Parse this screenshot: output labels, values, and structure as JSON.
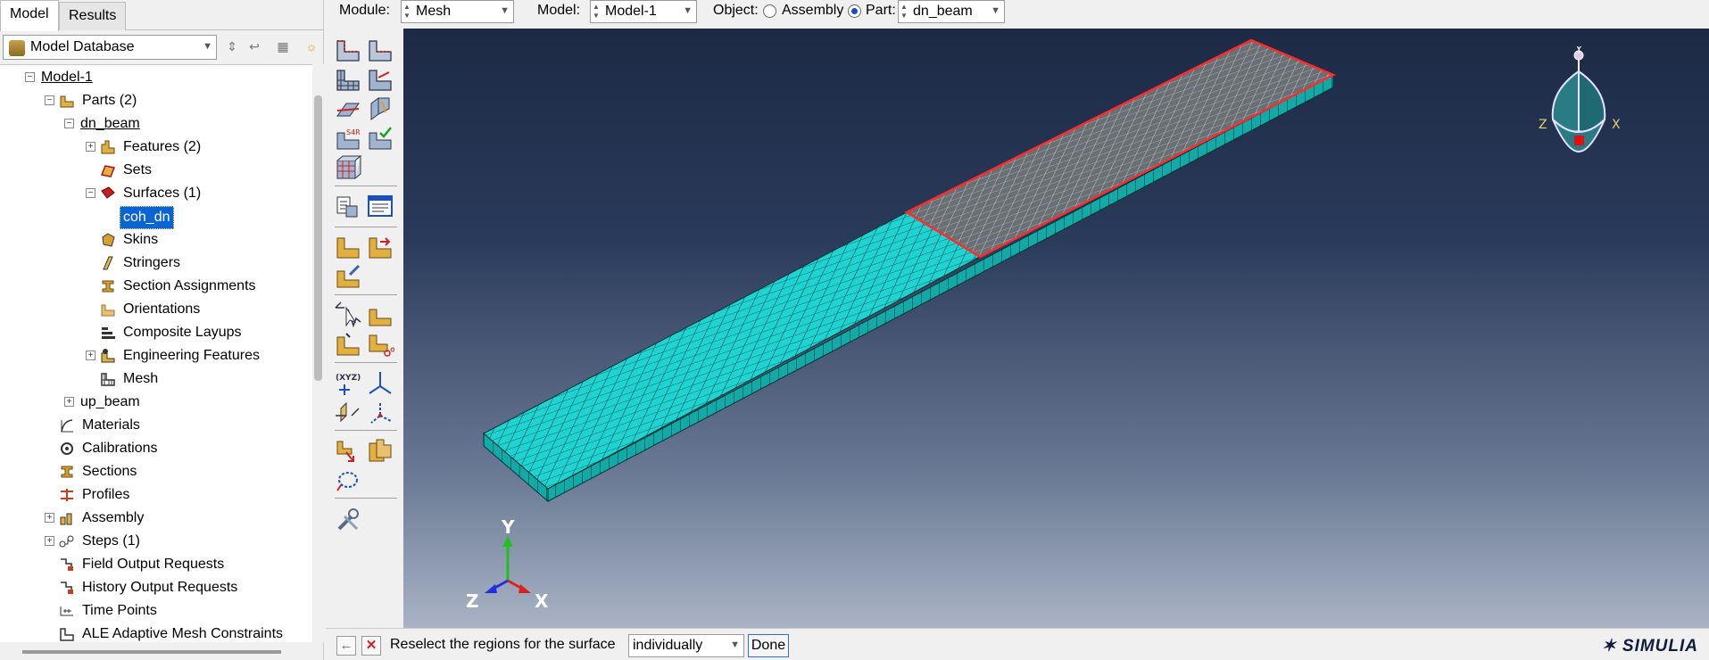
{
  "left_panel": {
    "tabs": [
      {
        "label": "Model"
      },
      {
        "label": "Results"
      }
    ],
    "database": {
      "label": "Model Database"
    }
  },
  "tree": {
    "model": "Model-1",
    "parts": "Parts (2)",
    "dn_beam": "dn_beam",
    "features": "Features (2)",
    "sets": "Sets",
    "surfaces": "Surfaces (1)",
    "coh_dn": "coh_dn",
    "skins": "Skins",
    "stringers": "Stringers",
    "section_assignments": "Section Assignments",
    "orientations": "Orientations",
    "composite_layups": "Composite Layups",
    "engineering_features": "Engineering Features",
    "mesh": "Mesh",
    "up_beam": "up_beam",
    "materials": "Materials",
    "calibrations": "Calibrations",
    "sections": "Sections",
    "profiles": "Profiles",
    "assembly": "Assembly",
    "steps": "Steps (1)",
    "field_output": "Field Output Requests",
    "history_output": "History Output Requests",
    "time_points": "Time Points",
    "ale": "ALE Adaptive Mesh Constraints"
  },
  "toolbar": {
    "module_label": "Module:",
    "module_value": "Mesh",
    "model_label": "Model:",
    "model_value": "Model-1",
    "object_label": "Object:",
    "assembly_label": "Assembly",
    "part_label": "Part:",
    "part_value": "dn_beam",
    "object_selected": "Part"
  },
  "viewport": {
    "triad_y": "Y",
    "triad_z": "Z",
    "triad_x": "X",
    "view_y": "Y",
    "view_z": "Z",
    "view_x": "X",
    "colors": {
      "mesh": "#1fd4d0",
      "selected_edge": "#ff2a2a",
      "selected_face": "#6a6f73"
    }
  },
  "prompt": {
    "text": "Reselect the regions for the surface",
    "method": "individually",
    "done_label": "Done",
    "logo": "SIMULIA"
  }
}
